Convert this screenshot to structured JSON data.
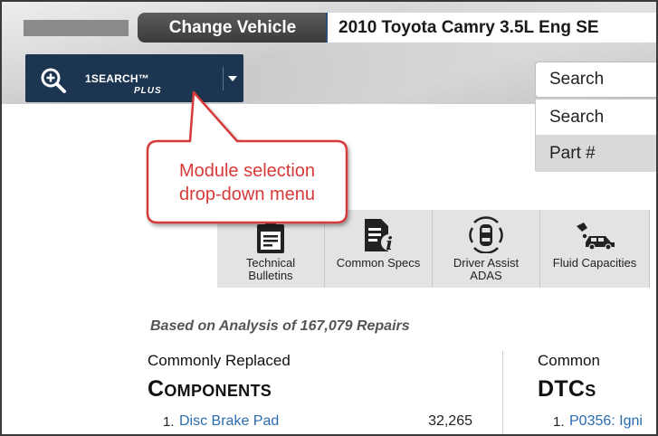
{
  "header": {
    "change_vehicle_label": "Change Vehicle",
    "vehicle_name": "2010 Toyota Camry 3.5L Eng SE"
  },
  "module": {
    "name": "1SEARCH™",
    "suffix": "PLUS",
    "icon": "magnifier-plus-icon",
    "caret_icon": "caret-down-icon"
  },
  "search": {
    "selected": "Search",
    "options": [
      "Search",
      "Part #"
    ]
  },
  "callout": {
    "line1": "Module selection",
    "line2": "drop-down menu"
  },
  "tabs": [
    {
      "line1": "Technical",
      "line2": "Bulletins",
      "icon": "clipboard-list-icon"
    },
    {
      "line1": "Common Specs",
      "line2": "",
      "icon": "document-info-icon"
    },
    {
      "line1": "Driver Assist",
      "line2": "ADAS",
      "icon": "car-sensor-icon"
    },
    {
      "line1": "Fluid Capacities",
      "line2": "",
      "icon": "car-oil-can-icon"
    }
  ],
  "analysis": {
    "note": "Based on Analysis of 167,079 Repairs",
    "components": {
      "subheading": "Commonly Replaced",
      "heading": "Components",
      "items": [
        {
          "num": "1.",
          "name": "Disc Brake Pad",
          "count": "32,265"
        }
      ]
    },
    "dtcs": {
      "subheading": "Common",
      "heading": "DTCs",
      "items": [
        {
          "num": "1.",
          "name": "P0356: Igni"
        }
      ]
    }
  },
  "colors": {
    "module_bg": "#1c3550",
    "callout_red": "#d63a3a",
    "link_blue": "#2a6cb0",
    "tab_bg": "#e3e3e3"
  }
}
